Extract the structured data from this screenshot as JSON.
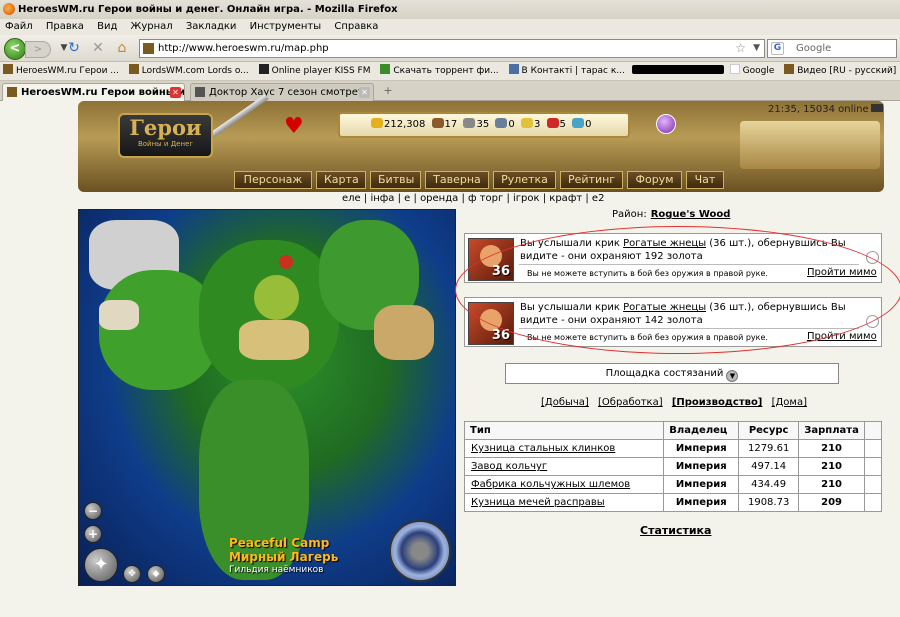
{
  "window": {
    "title": "HeroesWM.ru Герои войны и денег. Онлайн игра. - Mozilla Firefox"
  },
  "menu": [
    "Файл",
    "Правка",
    "Вид",
    "Журнал",
    "Закладки",
    "Инструменты",
    "Справка"
  ],
  "nav": {
    "back": "<",
    "forward": ">",
    "url": "http://www.heroeswm.ru/map.php",
    "search_placeholder": "Google"
  },
  "bookmarks": [
    {
      "label": "HeroesWM.ru Герои ..."
    },
    {
      "label": "LordsWM.com Lords o..."
    },
    {
      "label": "Online player KISS FM"
    },
    {
      "label": "Скачать торрент фи..."
    },
    {
      "label": "В Контакті | тарас к..."
    },
    {
      "label": "Google"
    },
    {
      "label": "Видео [RU - русский]"
    }
  ],
  "tabs": [
    {
      "label": "HeroesWM.ru Герои войны и ден...",
      "active": true
    },
    {
      "label": "Доктор Хаус 7 сезон смотреть онлай...",
      "active": false
    }
  ],
  "header": {
    "logo_main": "Герои",
    "logo_sub": "Войны и Денег",
    "time_online": "21:35, 15034 online",
    "resources": [
      "212,308",
      "17",
      "35",
      "0",
      "3",
      "5",
      "0"
    ]
  },
  "game_nav": [
    "Персонаж",
    "Карта",
    "Битвы",
    "Таверна",
    "Рулетка",
    "Рейтинг",
    "Форум",
    "Чат"
  ],
  "sublinks": [
    "еле",
    "інфа",
    "е",
    "оренда",
    "ф торг",
    "ігрок",
    "крафт",
    "е2"
  ],
  "map": {
    "name_en": "Peaceful Camp",
    "name_ru": "Мирный Лагерь",
    "guild": "Гильдия наёмников",
    "zoom_out": "−",
    "zoom_in": "+"
  },
  "district": {
    "label": "Район:",
    "name": "Rogue's Wood"
  },
  "encounters": [
    {
      "text_pre": "Вы услышали крик",
      "monster": "Рогатые жнецы",
      "text_post": "(36 шт.), обернувшись Вы видите - они охраняют 192 золота",
      "count": "36",
      "warning": "Вы не можете вступить в бой без оружия в правой руке.",
      "pass": "Пройти мимо"
    },
    {
      "text_pre": "Вы услышали крик",
      "monster": "Рогатые жнецы",
      "text_post": "(36 шт.), обернувшись Вы видите - они охраняют 142 золота",
      "count": "36",
      "warning": "Вы не можете вступить в бой без оружия в правой руке.",
      "pass": "Пройти мимо"
    }
  ],
  "arena": {
    "label": "Площадка состязаний"
  },
  "factory_tabs": [
    "[Добыча]",
    "[Обработка]",
    "[Производство]",
    "[Дома]"
  ],
  "factory_table": {
    "headers": [
      "Тип",
      "Владелец",
      "Ресурс",
      "Зарплата"
    ],
    "rows": [
      [
        "Кузница стальных клинков",
        "Империя",
        "1279.61",
        "210"
      ],
      [
        "Завод кольчуг",
        "Империя",
        "497.14",
        "210"
      ],
      [
        "Фабрика кольчужных шлемов",
        "Империя",
        "434.49",
        "210"
      ],
      [
        "Кузница мечей расправы",
        "Империя",
        "1908.73",
        "209"
      ]
    ]
  },
  "stats_link": "Статистика"
}
